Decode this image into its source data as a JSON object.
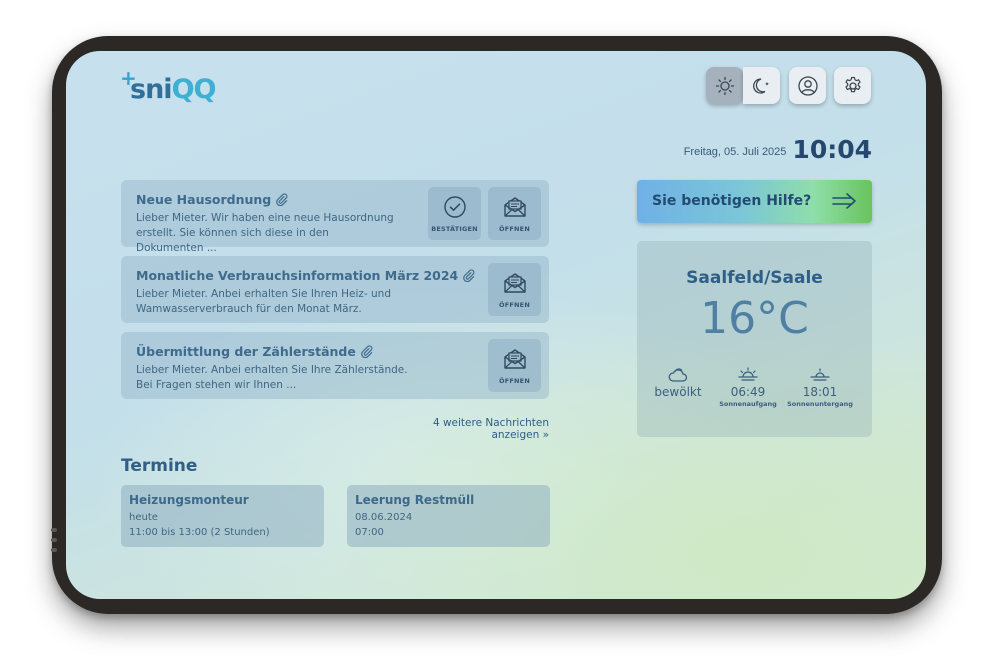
{
  "brand": {
    "logo_plus": "+",
    "logo_text_a": "sni",
    "logo_text_b": "QQ"
  },
  "header": {
    "buttons": [
      {
        "name": "light-mode",
        "icon": "sun-icon",
        "active": true
      },
      {
        "name": "dark-mode",
        "icon": "moon-icon",
        "active": false
      },
      {
        "name": "profile",
        "icon": "user-icon",
        "active": false
      },
      {
        "name": "settings",
        "icon": "gear-icon",
        "active": false
      }
    ],
    "date": "Freitag, 05. Juli 2025",
    "time": "10:04"
  },
  "messages": [
    {
      "title": "Neue Hausordnung",
      "body": "Lieber Mieter. Wir haben eine neue Hausordnung erstellt. Sie können sich diese in den Dokumenten ...",
      "confirm_label": "BESTÄTIGEN",
      "open_label": "ÖFFNEN"
    },
    {
      "title": "Monatliche Verbrauchsinformation März 2024",
      "body": "Lieber Mieter. Anbei erhalten Sie Ihren Heiz- und Wamwasserverbrauch für den Monat März.",
      "open_label": "ÖFFNEN"
    },
    {
      "title": "Übermittlung der Zählerstände",
      "body": "Lieber Mieter. Anbei erhalten Sie Ihre Zählerstände. Bei Fragen stehen wir Ihnen ...",
      "open_label": "ÖFFNEN"
    }
  ],
  "more_link": "4 weitere Nachrichten anzeigen »",
  "termine": {
    "heading": "Termine",
    "items": [
      {
        "title": "Heizungsmonteur",
        "line1": "heute",
        "line2": "11:00 bis 13:00 (2 Stunden)"
      },
      {
        "title": "Leerung Restmüll",
        "line1": "08.06.2024",
        "line2": "07:00"
      }
    ]
  },
  "help": {
    "label": "Sie benötigen Hilfe?",
    "icon": "arrow-right-icon"
  },
  "weather": {
    "city": "Saalfeld/Saale",
    "temperature": "16°C",
    "condition": "bewölkt",
    "sunrise_time": "06:49",
    "sunrise_label": "Sonnenaufgang",
    "sunset_time": "18:01",
    "sunset_label": "Sonnenuntergang"
  },
  "colors": {
    "accent": "#2f5f86",
    "help_gradient_start": "#6fb1e6",
    "help_gradient_end": "#69c45c"
  }
}
